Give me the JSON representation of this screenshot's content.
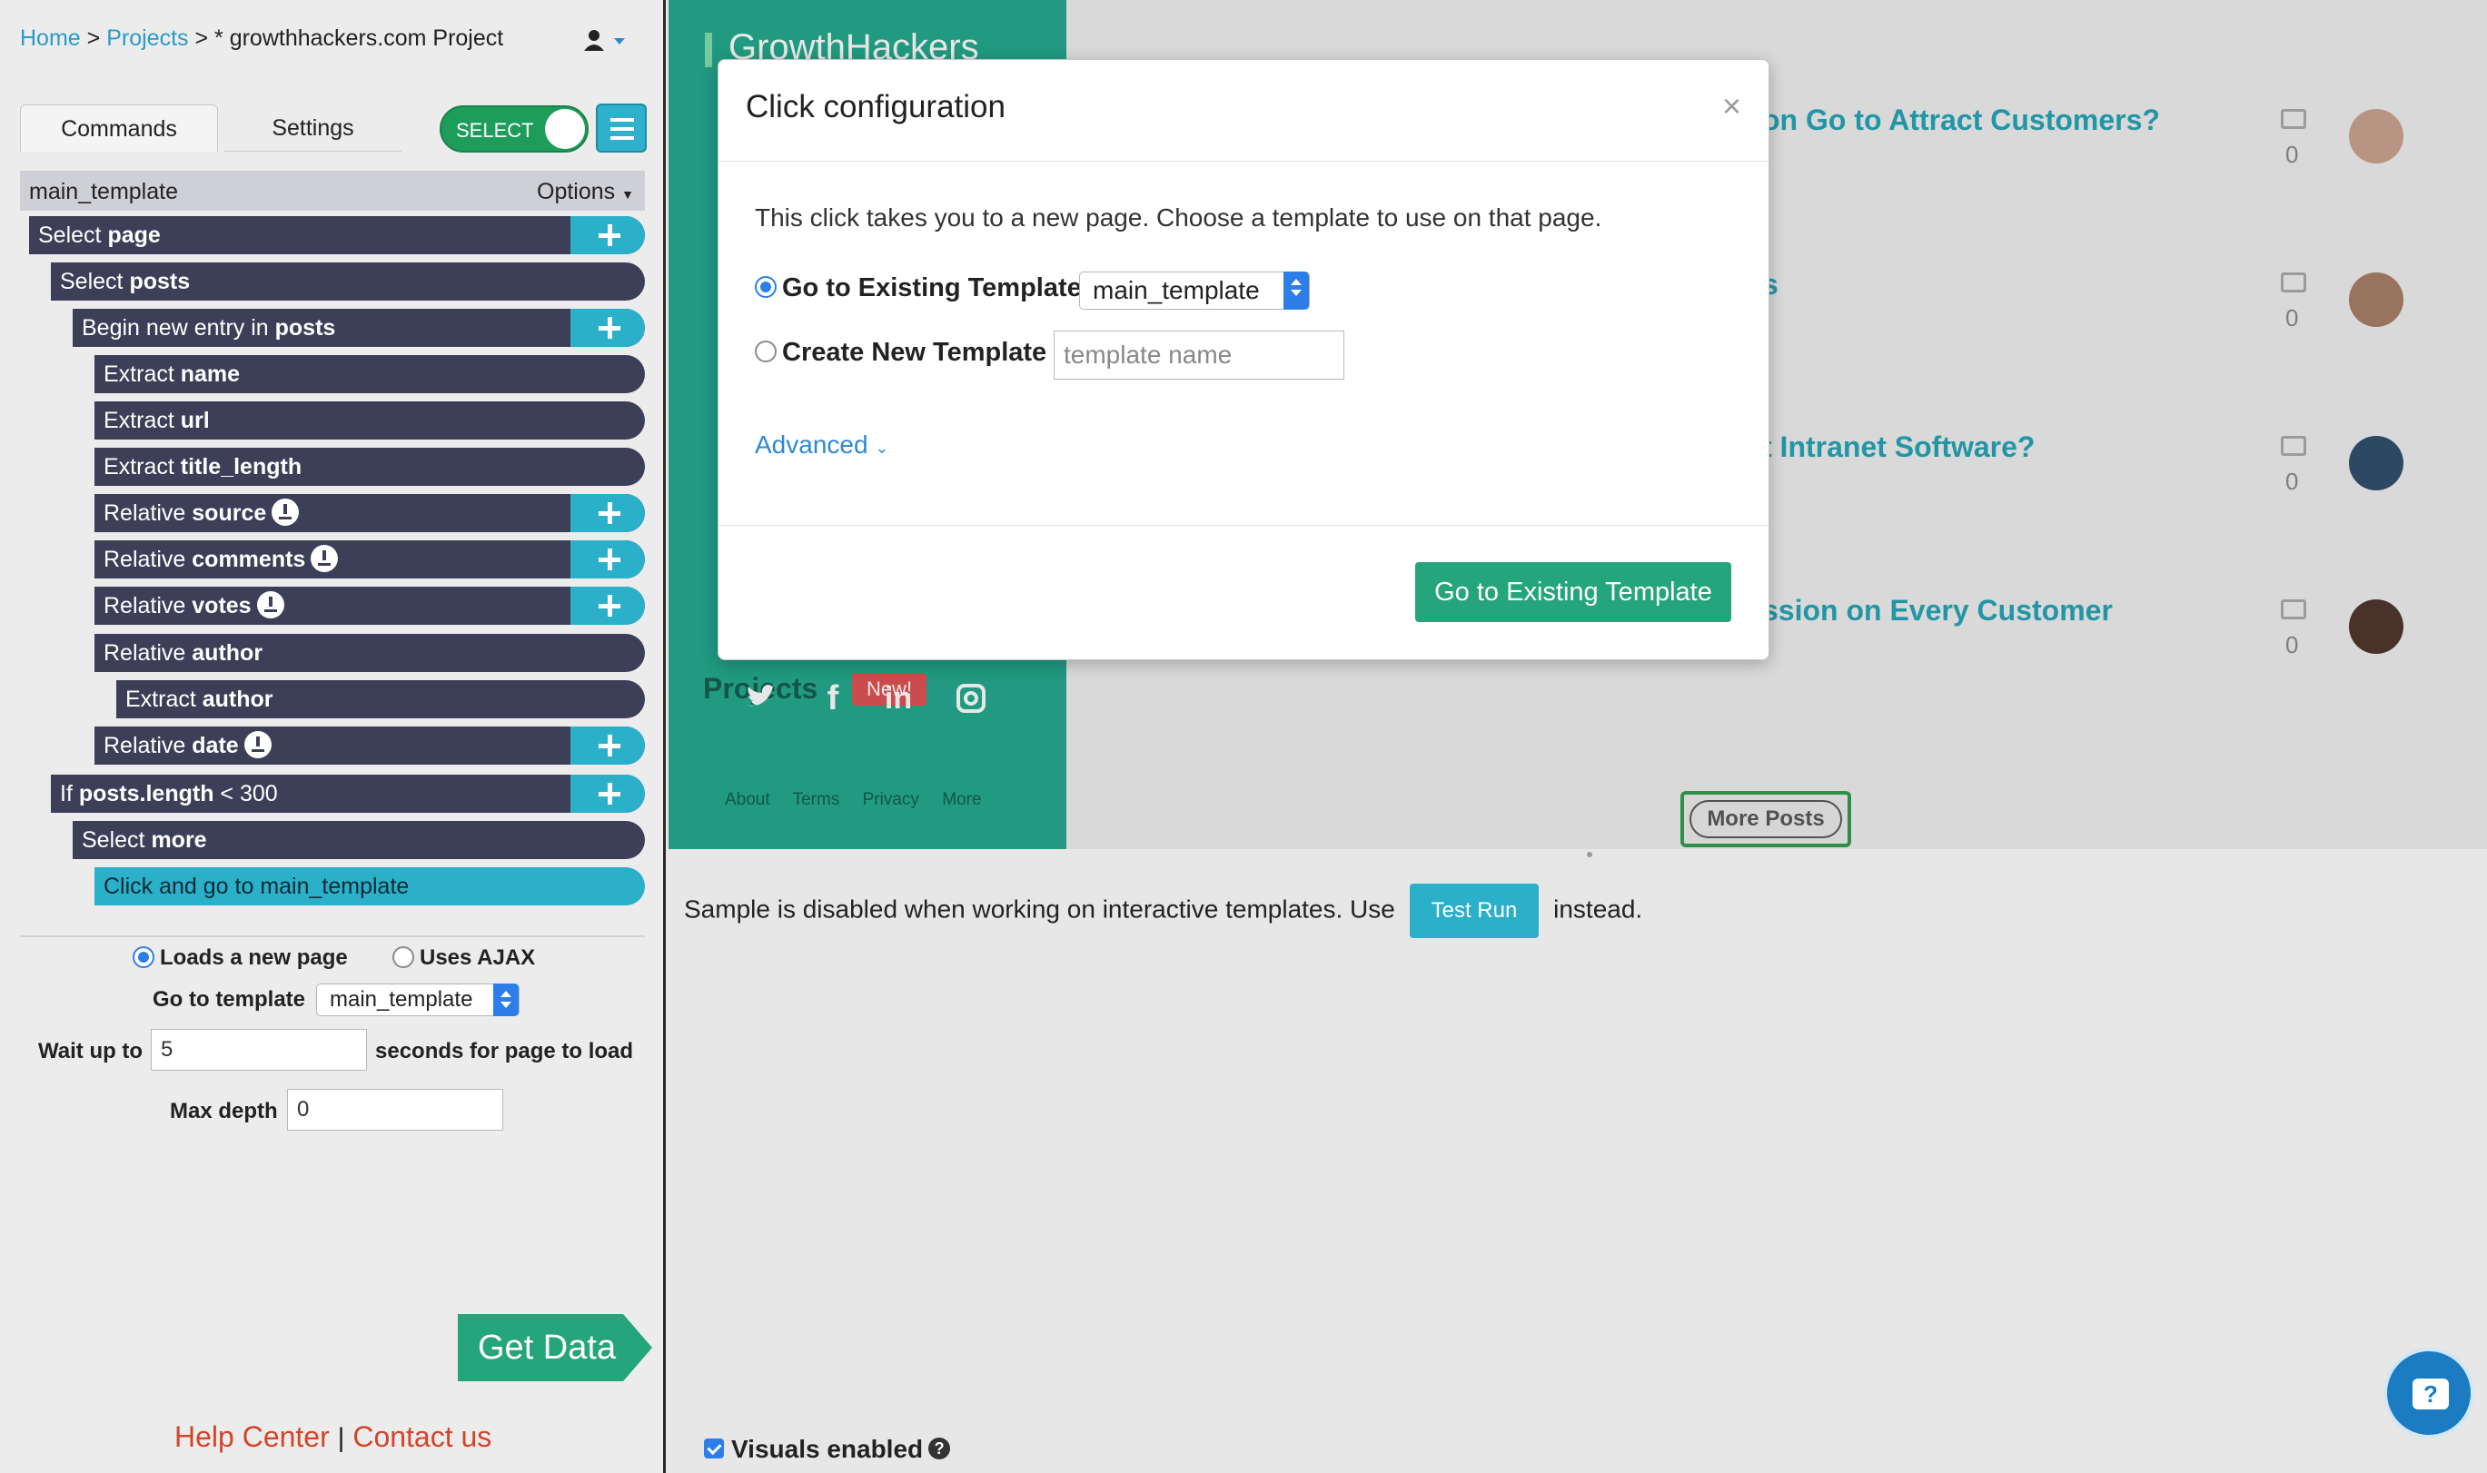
{
  "breadcrumb": {
    "home": "Home",
    "sep1": ">",
    "projects": "Projects",
    "sep2": ">",
    "current": "* growthhackers.com Project"
  },
  "tabs": {
    "commands": "Commands",
    "settings": "Settings"
  },
  "toggle": {
    "label": "SELECT"
  },
  "template_header": {
    "name": "main_template",
    "options": "Options"
  },
  "commands": [
    {
      "prefix": "Select",
      "target": "page"
    },
    {
      "prefix": "Select",
      "target": "posts"
    },
    {
      "prefix": "Begin new entry in",
      "target": "posts"
    },
    {
      "prefix": "Extract",
      "target": "name"
    },
    {
      "prefix": "Extract",
      "target": "url"
    },
    {
      "prefix": "Extract",
      "target": "title_length"
    },
    {
      "prefix": "Relative",
      "target": "source"
    },
    {
      "prefix": "Relative",
      "target": "comments"
    },
    {
      "prefix": "Relative",
      "target": "votes"
    },
    {
      "prefix": "Relative",
      "target": "author"
    },
    {
      "prefix": "Extract",
      "target": "author"
    },
    {
      "prefix": "Relative",
      "target": "date"
    },
    {
      "prefix": "If",
      "target": "posts.length",
      "suffix": "< 300"
    },
    {
      "prefix": "Select",
      "target": "more"
    },
    {
      "prefix": "Click and go to main_template",
      "target": ""
    }
  ],
  "click_options": {
    "loads_new_page": "Loads a new page",
    "uses_ajax": "Uses AJAX",
    "go_to_template_label": "Go to template",
    "go_to_template_value": "main_template",
    "wait_label": "Wait up to",
    "wait_value": "5",
    "wait_suffix": "seconds for page to load",
    "max_depth_label": "Max depth",
    "max_depth_value": "0"
  },
  "get_data": "Get Data",
  "help": {
    "help_center": "Help Center",
    "sep": "|",
    "contact": "Contact us"
  },
  "website": {
    "logo": "GrowthHackers",
    "projects": "Projects",
    "new_badge": "New!",
    "footer": [
      "About",
      "Terms",
      "Privacy",
      "More"
    ],
    "posts": [
      {
        "title": "on Go to Attract Customers?",
        "comments": "0"
      },
      {
        "title": "s",
        "comments": "0"
      },
      {
        "title": "t Intranet Software?",
        "comments": "0"
      },
      {
        "title": "ssion on Every Customer",
        "comments": "0"
      }
    ],
    "more_posts": "More Posts"
  },
  "modal": {
    "title": "Click configuration",
    "close": "×",
    "description": "This click takes you to a new page. Choose a template to use on that page.",
    "existing_label": "Go to Existing Template",
    "existing_value": "main_template",
    "new_label": "Create New Template",
    "new_placeholder": "template name",
    "advanced": "Advanced",
    "button": "Go to Existing Template"
  },
  "sample": {
    "before": "Sample is disabled when working on interactive templates. Use",
    "button": "Test Run",
    "after": "instead."
  },
  "visuals": {
    "label": "Visuals enabled"
  },
  "colors": {
    "command_bg": "#3d3f58",
    "accent_teal": "#2bb0c9",
    "green": "#25a57c",
    "link_red": "#d2452a",
    "blue": "#2d7ee8"
  },
  "icons": [
    "user-icon",
    "menu-icon",
    "plus-icon",
    "download-icon",
    "chevron-down-icon",
    "close-icon",
    "twitter-icon",
    "facebook-icon",
    "linkedin-icon",
    "instagram-icon",
    "comment-icon",
    "question-icon",
    "chat-icon"
  ]
}
